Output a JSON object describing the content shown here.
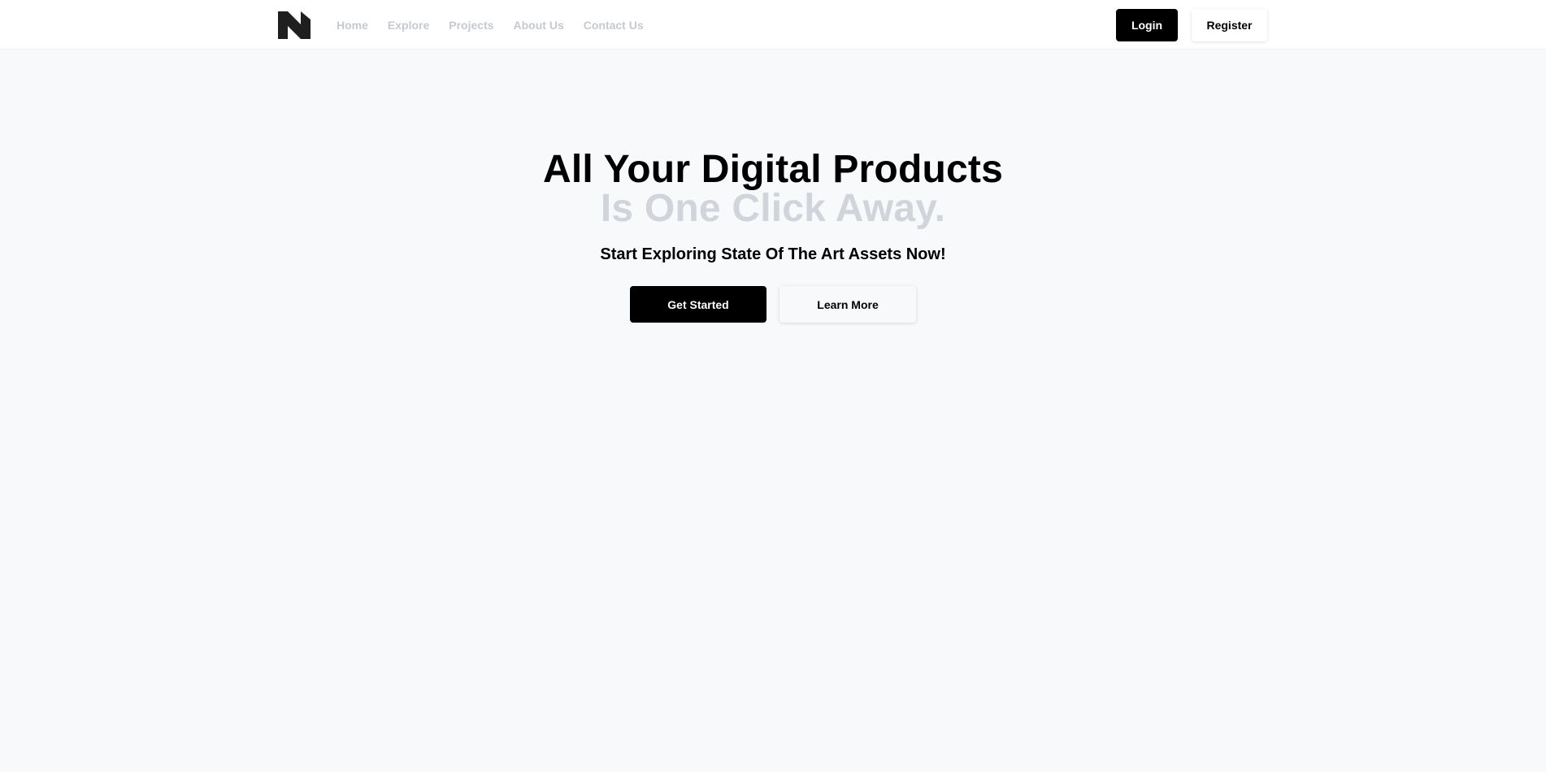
{
  "header": {
    "logo_icon": "n-logo-icon",
    "nav": [
      {
        "label": "Home"
      },
      {
        "label": "Explore"
      },
      {
        "label": "Projects"
      },
      {
        "label": "About Us"
      },
      {
        "label": "Contact Us"
      }
    ],
    "login_label": "Login",
    "register_label": "Register"
  },
  "hero": {
    "title_line1": "All Your Digital Products",
    "title_line2": "Is One Click Away.",
    "tagline": "Start Exploring State Of The Art Assets Now!",
    "primary_button": "Get Started",
    "secondary_button": "Learn More"
  },
  "colors": {
    "background": "#f8f9fb",
    "header_bg": "#ffffff",
    "nav_link": "#c6c9d1",
    "title_muted": "#d1d4da",
    "primary": "#000000"
  }
}
